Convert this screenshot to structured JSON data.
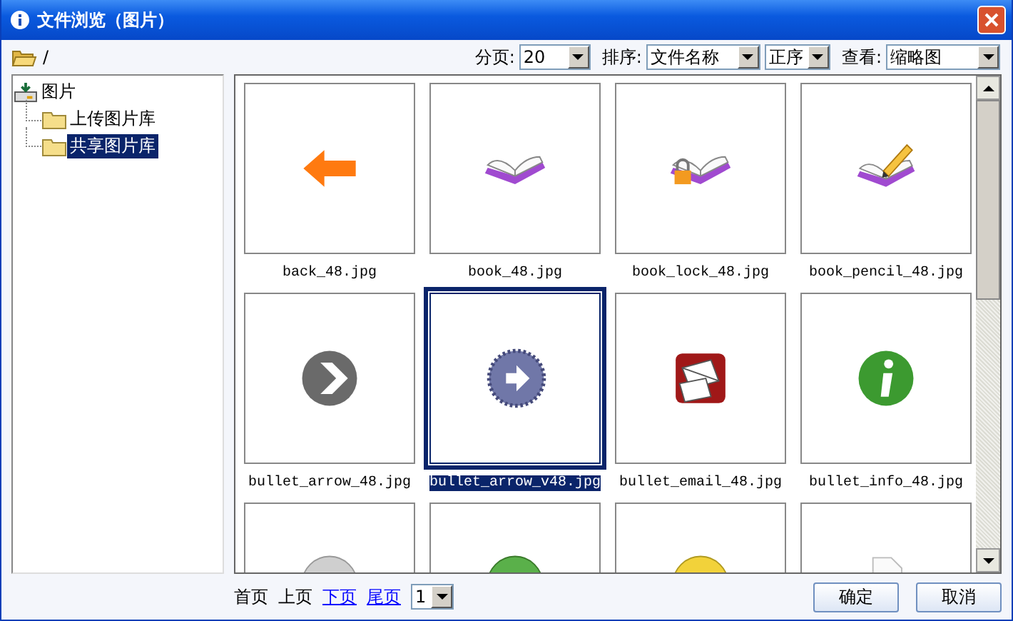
{
  "window": {
    "title": "文件浏览（图片）"
  },
  "path": "/",
  "toolbar": {
    "page_size_label": "分页:",
    "page_size": "20",
    "sort_label": "排序:",
    "sort_field": "文件名称",
    "sort_order": "正序",
    "view_label": "查看:",
    "view": "缩略图"
  },
  "tree": {
    "label": "图片",
    "children": [
      {
        "label": "上传图片库",
        "selected": false
      },
      {
        "label": "共享图片库",
        "selected": true
      }
    ]
  },
  "files": [
    {
      "kind": "arrow-left",
      "name": "back_48.jpg",
      "selected": false
    },
    {
      "kind": "book",
      "name": "book_48.jpg",
      "selected": false
    },
    {
      "kind": "book-lock",
      "name": "book_lock_48.jpg",
      "selected": false
    },
    {
      "kind": "book-pencil",
      "name": "book_pencil_48.jpg",
      "selected": false
    },
    {
      "kind": "chevron-circle",
      "name": "bullet_arrow_48.jpg",
      "selected": false
    },
    {
      "kind": "arrow-seal",
      "name": "bullet_arrow_v48.jpg",
      "selected": true
    },
    {
      "kind": "envelope",
      "name": "bullet_email_48.jpg",
      "selected": false
    },
    {
      "kind": "info",
      "name": "bullet_info_48.jpg",
      "selected": false
    },
    {
      "kind": "grey-disc",
      "selected": false
    },
    {
      "kind": "green-disc",
      "selected": false
    },
    {
      "kind": "yellow-disc",
      "selected": false
    },
    {
      "kind": "page",
      "selected": false
    }
  ],
  "pager": [
    {
      "label": "首页",
      "disabled": true
    },
    {
      "label": "上页",
      "disabled": true
    },
    {
      "label": "下页",
      "disabled": false
    },
    {
      "label": "尾页",
      "disabled": false
    }
  ],
  "page": "1",
  "buttons": [
    "确定",
    "取消"
  ]
}
